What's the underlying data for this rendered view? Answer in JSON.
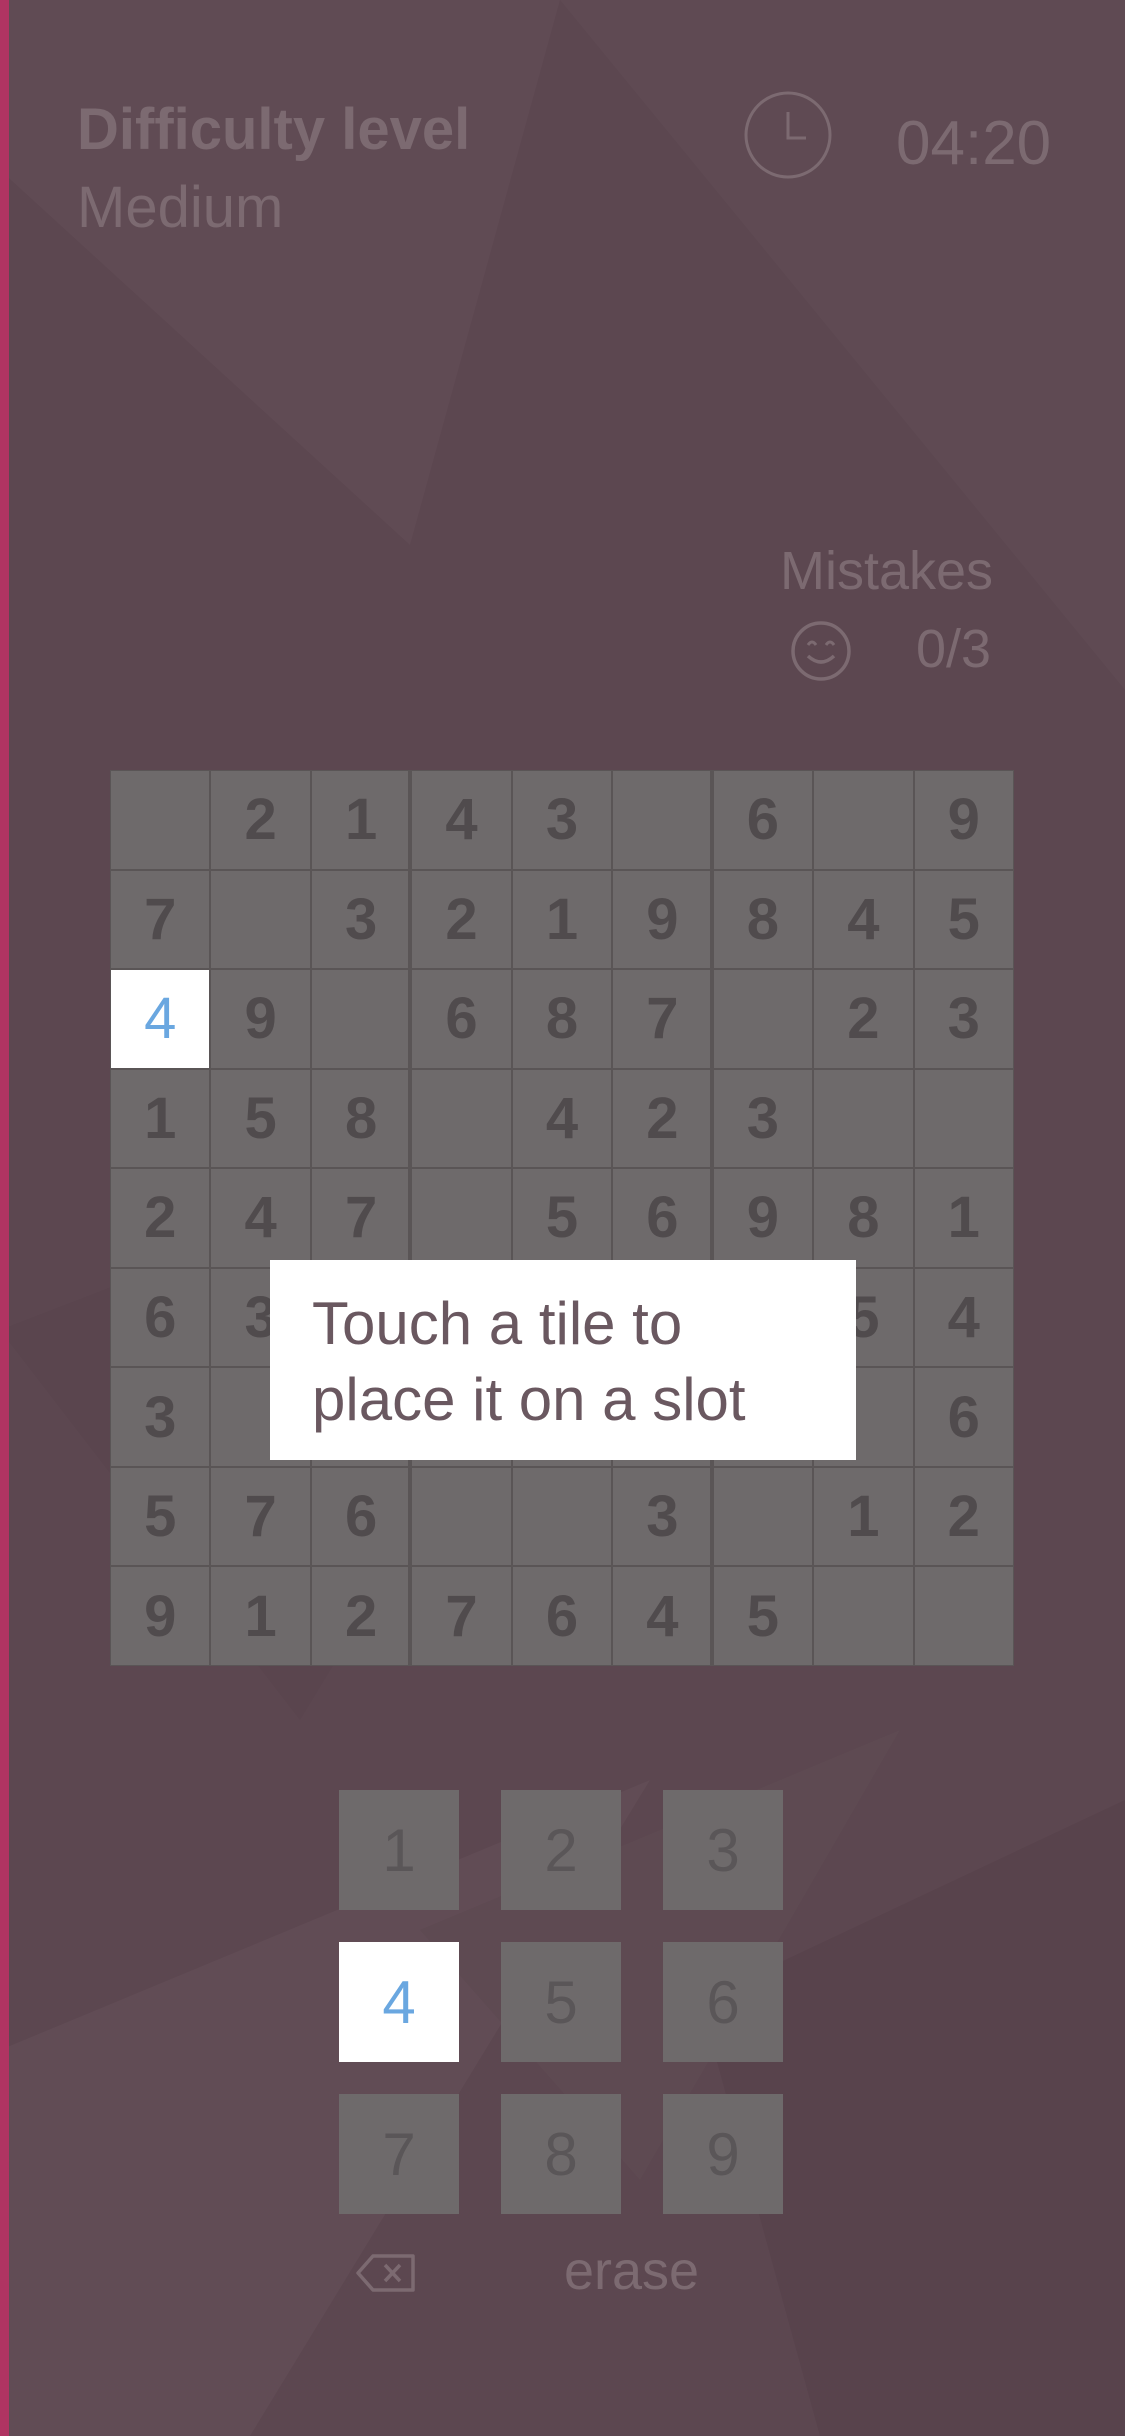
{
  "colors": {
    "background": "#5c4750",
    "accent": "#b03462",
    "highlight_digit": "#6aa7e0"
  },
  "header": {
    "difficulty_label": "Difficulty level",
    "difficulty_value": "Medium",
    "clock_icon": "clock-icon",
    "timer": "04:20"
  },
  "mistakes": {
    "label": "Mistakes",
    "icon": "smile-icon",
    "count": "0/3"
  },
  "board": {
    "selected": {
      "row": 2,
      "col": 0
    },
    "rows": [
      [
        "",
        "2",
        "1",
        "4",
        "3",
        "",
        "6",
        "",
        "9"
      ],
      [
        "7",
        "",
        "3",
        "2",
        "1",
        "9",
        "8",
        "4",
        "5"
      ],
      [
        "4",
        "9",
        "",
        "6",
        "8",
        "7",
        "",
        "2",
        "3"
      ],
      [
        "1",
        "5",
        "8",
        "",
        "4",
        "2",
        "3",
        "",
        ""
      ],
      [
        "2",
        "4",
        "7",
        "",
        "5",
        "6",
        "9",
        "8",
        "1"
      ],
      [
        "6",
        "3",
        "",
        "",
        "",
        "",
        "",
        "5",
        "4"
      ],
      [
        "3",
        "",
        "",
        "",
        "",
        "",
        "",
        "",
        "6"
      ],
      [
        "5",
        "7",
        "6",
        "",
        "",
        "3",
        "",
        "1",
        "2"
      ],
      [
        "9",
        "1",
        "2",
        "7",
        "6",
        "4",
        "5",
        "",
        ""
      ]
    ]
  },
  "tooltip": {
    "text": "Touch a tile to place it on a slot"
  },
  "keypad": {
    "active": "4",
    "keys": [
      "1",
      "2",
      "3",
      "4",
      "5",
      "6",
      "7",
      "8",
      "9"
    ]
  },
  "erase": {
    "icon": "backspace-icon",
    "label": "erase"
  }
}
